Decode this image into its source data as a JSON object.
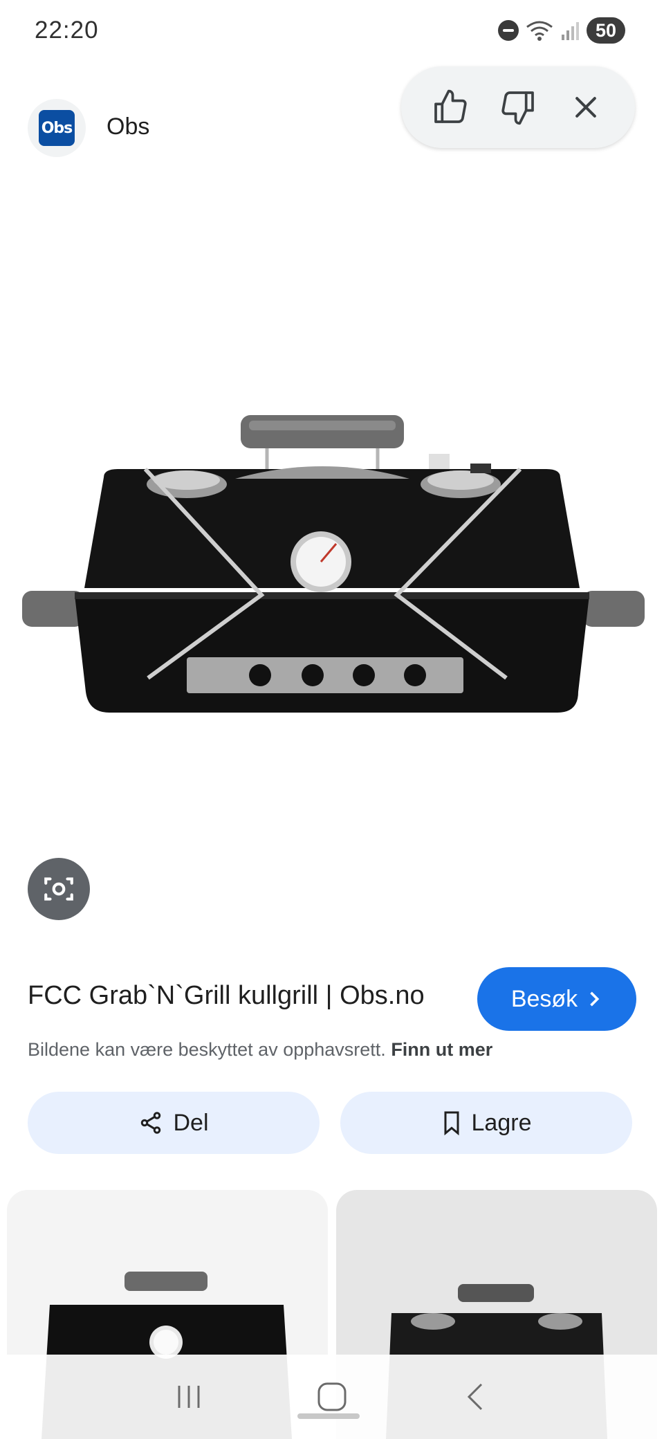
{
  "status_bar": {
    "time": "22:20",
    "battery": "50",
    "icons": [
      "do-not-disturb-icon",
      "wifi-icon",
      "signal-icon",
      "battery-icon"
    ]
  },
  "source": {
    "logo_text": "Obs",
    "name": "Obs"
  },
  "feedback": {
    "icons": [
      "thumbs-up-icon",
      "thumbs-down-icon",
      "close-icon"
    ]
  },
  "result": {
    "title": "FCC Grab`N`Grill kullgrill | Obs.no",
    "visit_label": "Besøk",
    "copyright_text": "Bildene kan være beskyttet av opphavsrett.",
    "learn_more": "Finn ut mer"
  },
  "actions": {
    "share_label": "Del",
    "save_label": "Lagre"
  },
  "colors": {
    "accent": "#1a73e8",
    "chip_bg": "#e8f0fe",
    "brand": "#0b4ea2"
  }
}
